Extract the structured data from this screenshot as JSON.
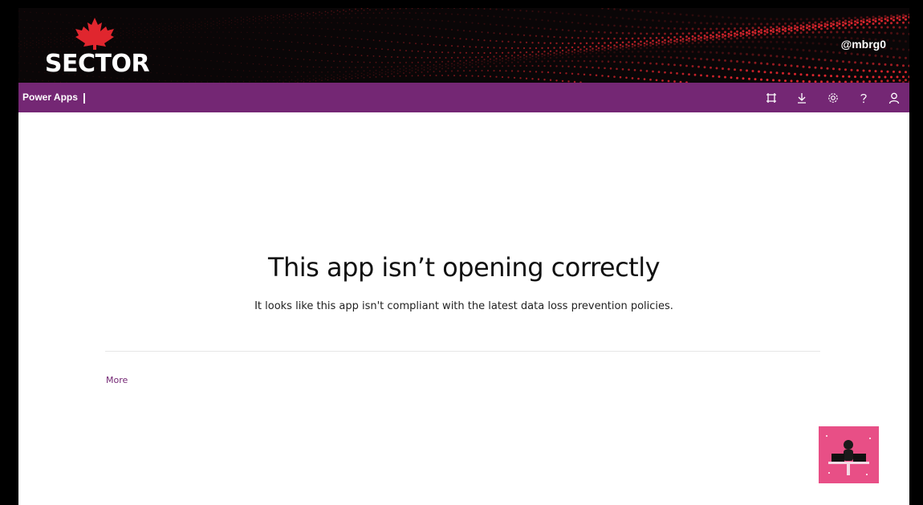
{
  "banner": {
    "logo_text": "SECTOR",
    "handle": "@mbrg0"
  },
  "topbar": {
    "app_name": "Power Apps",
    "separator": "|",
    "icons": [
      "fit-screen-icon",
      "download-icon",
      "gear-icon",
      "help-icon",
      "user-icon"
    ]
  },
  "main": {
    "title": "This app isn’t opening correctly",
    "message": "It looks like this app isn't compliant with the latest data loss prevention policies.",
    "more_link": "More"
  },
  "colors": {
    "brand_purple": "#742774",
    "banner_red": "#e0262e",
    "avatar_pink": "#e84f86"
  }
}
